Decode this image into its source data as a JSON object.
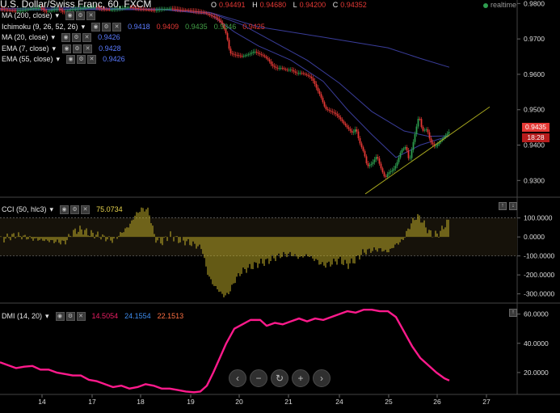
{
  "header": {
    "symbol_title": "U.S. Dollar/Swiss Franc, 60, FXCM",
    "ohlc": [
      {
        "key": "O",
        "value": "0.94491"
      },
      {
        "key": "H",
        "value": "0.94680"
      },
      {
        "key": "L",
        "value": "0.94200"
      },
      {
        "key": "C",
        "value": "0.94352"
      }
    ],
    "realtime_label": "realtime"
  },
  "legend": [
    {
      "label": "MA (200, close)",
      "values": []
    },
    {
      "label": "Ichimoku (9, 26, 52, 26)",
      "values": [
        {
          "text": "0.9418",
          "color": "#5b7bff"
        },
        {
          "text": "0.9409",
          "color": "#e53935"
        },
        {
          "text": "0.9435",
          "color": "#43a047"
        },
        {
          "text": "0.9346",
          "color": "#43a047"
        },
        {
          "text": "0.9425",
          "color": "#e53935"
        }
      ]
    },
    {
      "label": "MA (20, close)",
      "values": [
        {
          "text": "0.9426",
          "color": "#5b7bff"
        }
      ]
    },
    {
      "label": "EMA (7, close)",
      "values": [
        {
          "text": "0.9428",
          "color": "#5b7bff"
        }
      ]
    },
    {
      "label": "EMA (55, close)",
      "values": [
        {
          "text": "0.9426",
          "color": "#5b7bff"
        }
      ]
    }
  ],
  "price_tags": {
    "last_price": "0.9435",
    "countdown": "18:28"
  },
  "cci_legend": {
    "label": "CCI (50, hlc3)",
    "value": "75.0734"
  },
  "dmi_legend": {
    "label": "DMI (14, 20)",
    "values": [
      {
        "text": "14.5054",
        "color": "#e91e63"
      },
      {
        "text": "24.1554",
        "color": "#3f8ef0"
      },
      {
        "text": "22.1513",
        "color": "#ff7043"
      }
    ]
  },
  "nav_buttons": [
    "‹",
    "−",
    "↻",
    "+",
    "›"
  ],
  "colors": {
    "up": "#2e9e4f",
    "down": "#e53935",
    "ma": "#3a3d9a",
    "trend": "#a8a81e",
    "cci": "#c8b42a",
    "dmi": "#ff1a8c"
  },
  "chart_data": [
    {
      "type": "candlestick",
      "title": "U.S. Dollar/Swiss Franc, 60, FXCM",
      "x_ticks": [
        "14",
        "17",
        "18",
        "19",
        "20",
        "21",
        "24",
        "25",
        "26",
        "27"
      ],
      "y_ticks": [
        "0.9800",
        "0.9700",
        "0.9600",
        "0.9500",
        "0.9400",
        "0.9300"
      ],
      "ylim": [
        0.9255,
        0.981
      ],
      "close_path": [
        [
          0,
          0.9785
        ],
        [
          10,
          0.9781
        ],
        [
          20,
          0.9779
        ],
        [
          30,
          0.9782
        ],
        [
          40,
          0.9786
        ],
        [
          50,
          0.9788
        ],
        [
          56,
          0.9777
        ],
        [
          64,
          0.9781
        ],
        [
          72,
          0.9786
        ],
        [
          78,
          0.9775
        ],
        [
          86,
          0.9782
        ],
        [
          96,
          0.9786
        ],
        [
          106,
          0.9788
        ],
        [
          118,
          0.9791
        ],
        [
          126,
          0.9784
        ],
        [
          136,
          0.9782
        ],
        [
          148,
          0.9786
        ],
        [
          160,
          0.979
        ],
        [
          170,
          0.9786
        ],
        [
          182,
          0.9782
        ],
        [
          192,
          0.9781
        ],
        [
          200,
          0.9784
        ],
        [
          212,
          0.9786
        ],
        [
          222,
          0.9782
        ],
        [
          232,
          0.9781
        ],
        [
          244,
          0.9777
        ],
        [
          252,
          0.9775
        ],
        [
          260,
          0.9766
        ],
        [
          266,
          0.9762
        ],
        [
          272,
          0.975
        ],
        [
          276,
          0.9735
        ],
        [
          280,
          0.971
        ],
        [
          284,
          0.966
        ],
        [
          290,
          0.9655
        ],
        [
          300,
          0.9651
        ],
        [
          308,
          0.9657
        ],
        [
          314,
          0.9665
        ],
        [
          320,
          0.9658
        ],
        [
          326,
          0.9652
        ],
        [
          332,
          0.964
        ],
        [
          336,
          0.9625
        ],
        [
          342,
          0.9617
        ],
        [
          348,
          0.9618
        ],
        [
          354,
          0.9612
        ],
        [
          360,
          0.9613
        ],
        [
          366,
          0.9603
        ],
        [
          372,
          0.9604
        ],
        [
          378,
          0.9599
        ],
        [
          384,
          0.9592
        ],
        [
          388,
          0.9578
        ],
        [
          392,
          0.9557
        ],
        [
          396,
          0.954
        ],
        [
          402,
          0.9503
        ],
        [
          408,
          0.9496
        ],
        [
          414,
          0.949
        ],
        [
          420,
          0.9476
        ],
        [
          426,
          0.9458
        ],
        [
          430,
          0.9448
        ],
        [
          436,
          0.9433
        ],
        [
          440,
          0.9448
        ],
        [
          444,
          0.941
        ],
        [
          450,
          0.9378
        ],
        [
          454,
          0.9339
        ],
        [
          460,
          0.9348
        ],
        [
          466,
          0.937
        ],
        [
          470,
          0.934
        ],
        [
          476,
          0.9306
        ],
        [
          480,
          0.9322
        ],
        [
          486,
          0.933
        ],
        [
          490,
          0.9345
        ],
        [
          496,
          0.9385
        ],
        [
          502,
          0.9396
        ],
        [
          506,
          0.9352
        ],
        [
          512,
          0.942
        ],
        [
          518,
          0.9485
        ],
        [
          522,
          0.944
        ],
        [
          528,
          0.9445
        ],
        [
          532,
          0.941
        ],
        [
          538,
          0.9395
        ],
        [
          544,
          0.941
        ],
        [
          550,
          0.9425
        ],
        [
          556,
          0.944
        ]
      ],
      "ma_lines": [
        {
          "name": "MA (200, close)",
          "points": [
            [
              0,
              0.9786
            ],
            [
              100,
              0.9788
            ],
            [
              200,
              0.9784
            ],
            [
              260,
              0.9775
            ],
            [
              320,
              0.9734
            ],
            [
              400,
              0.9705
            ],
            [
              480,
              0.9675
            ],
            [
              520,
              0.9645
            ],
            [
              556,
              0.962
            ]
          ]
        },
        {
          "name": "EMA (55, close)",
          "points": [
            [
              0,
              0.9782
            ],
            [
              100,
              0.9785
            ],
            [
              200,
              0.9784
            ],
            [
              260,
              0.9774
            ],
            [
              300,
              0.974
            ],
            [
              340,
              0.969
            ],
            [
              380,
              0.964
            ],
            [
              420,
              0.9575
            ],
            [
              460,
              0.9495
            ],
            [
              500,
              0.944
            ],
            [
              530,
              0.9425
            ],
            [
              556,
              0.9426
            ]
          ]
        },
        {
          "name": "MA (20, close)",
          "points": [
            [
              0,
              0.9782
            ],
            [
              200,
              0.9783
            ],
            [
              260,
              0.977
            ],
            [
              290,
              0.972
            ],
            [
              320,
              0.968
            ],
            [
              360,
              0.964
            ],
            [
              400,
              0.958
            ],
            [
              430,
              0.95
            ],
            [
              460,
              0.943
            ],
            [
              490,
              0.9365
            ],
            [
              520,
              0.94
            ],
            [
              556,
              0.9426
            ]
          ]
        }
      ],
      "trendline": [
        [
          452,
          0.9262
        ],
        [
          606,
          0.9508
        ]
      ]
    },
    {
      "type": "bar",
      "title": "CCI (50, hlc3)",
      "y_ticks": [
        "100.0000",
        "0.0000",
        "-100.0000",
        "-200.0000",
        "-300.0000"
      ],
      "ylim": [
        -340,
        205
      ],
      "levels": [
        100,
        -100
      ],
      "bar_path": [
        [
          0,
          -15
        ],
        [
          20,
          10
        ],
        [
          40,
          -10
        ],
        [
          60,
          -20
        ],
        [
          80,
          -30
        ],
        [
          90,
          25
        ],
        [
          100,
          40
        ],
        [
          110,
          20
        ],
        [
          120,
          10
        ],
        [
          130,
          -5
        ],
        [
          140,
          -20
        ],
        [
          150,
          20
        ],
        [
          160,
          60
        ],
        [
          168,
          120
        ],
        [
          176,
          150
        ],
        [
          184,
          140
        ],
        [
          192,
          -10
        ],
        [
          200,
          -30
        ],
        [
          210,
          10
        ],
        [
          220,
          -15
        ],
        [
          230,
          -25
        ],
        [
          240,
          -40
        ],
        [
          250,
          -60
        ],
        [
          256,
          -180
        ],
        [
          262,
          -240
        ],
        [
          270,
          -280
        ],
        [
          278,
          -315
        ],
        [
          284,
          -290
        ],
        [
          292,
          -220
        ],
        [
          300,
          -180
        ],
        [
          310,
          -160
        ],
        [
          320,
          -140
        ],
        [
          330,
          -130
        ],
        [
          340,
          -110
        ],
        [
          350,
          -95
        ],
        [
          360,
          -90
        ],
        [
          370,
          -110
        ],
        [
          380,
          -95
        ],
        [
          390,
          -120
        ],
        [
          400,
          -150
        ],
        [
          410,
          -140
        ],
        [
          420,
          -120
        ],
        [
          430,
          -150
        ],
        [
          440,
          -120
        ],
        [
          450,
          -80
        ],
        [
          460,
          -70
        ],
        [
          470,
          -65
        ],
        [
          480,
          -80
        ],
        [
          490,
          -40
        ],
        [
          498,
          -20
        ],
        [
          504,
          30
        ],
        [
          510,
          80
        ],
        [
          516,
          110
        ],
        [
          520,
          100
        ],
        [
          526,
          60
        ],
        [
          532,
          20
        ],
        [
          538,
          10
        ],
        [
          544,
          20
        ],
        [
          550,
          60
        ],
        [
          556,
          88
        ]
      ]
    },
    {
      "type": "line",
      "title": "DMI (14, 20)",
      "y_ticks": [
        "60.0000",
        "40.0000",
        "20.0000"
      ],
      "ylim": [
        5,
        67
      ],
      "series": [
        {
          "name": "DMI (14, 20)",
          "points": [
            [
              0,
              27
            ],
            [
              10,
              25
            ],
            [
              20,
              23
            ],
            [
              30,
              24
            ],
            [
              40,
              24.5
            ],
            [
              50,
              22
            ],
            [
              60,
              22
            ],
            [
              70,
              20
            ],
            [
              80,
              19
            ],
            [
              90,
              18
            ],
            [
              100,
              18
            ],
            [
              110,
              15
            ],
            [
              120,
              14
            ],
            [
              130,
              12
            ],
            [
              140,
              10
            ],
            [
              150,
              11
            ],
            [
              160,
              9
            ],
            [
              170,
              10
            ],
            [
              180,
              12
            ],
            [
              190,
              11
            ],
            [
              200,
              9
            ],
            [
              210,
              9
            ],
            [
              220,
              8
            ],
            [
              230,
              7
            ],
            [
              240,
              6.5
            ],
            [
              248,
              7
            ],
            [
              256,
              11
            ],
            [
              264,
              20
            ],
            [
              272,
              30
            ],
            [
              280,
              40
            ],
            [
              290,
              50
            ],
            [
              300,
              53
            ],
            [
              310,
              56
            ],
            [
              322,
              56
            ],
            [
              330,
              52
            ],
            [
              340,
              54
            ],
            [
              350,
              53
            ],
            [
              360,
              55
            ],
            [
              370,
              57
            ],
            [
              380,
              55
            ],
            [
              390,
              57
            ],
            [
              400,
              56
            ],
            [
              410,
              58
            ],
            [
              420,
              60
            ],
            [
              430,
              62
            ],
            [
              440,
              61
            ],
            [
              450,
              63
            ],
            [
              460,
              63
            ],
            [
              470,
              62
            ],
            [
              480,
              62
            ],
            [
              490,
              58
            ],
            [
              500,
              48
            ],
            [
              510,
              38
            ],
            [
              520,
              30
            ],
            [
              530,
              25
            ],
            [
              540,
              20
            ],
            [
              550,
              16
            ],
            [
              556,
              14.5
            ]
          ]
        }
      ]
    }
  ]
}
